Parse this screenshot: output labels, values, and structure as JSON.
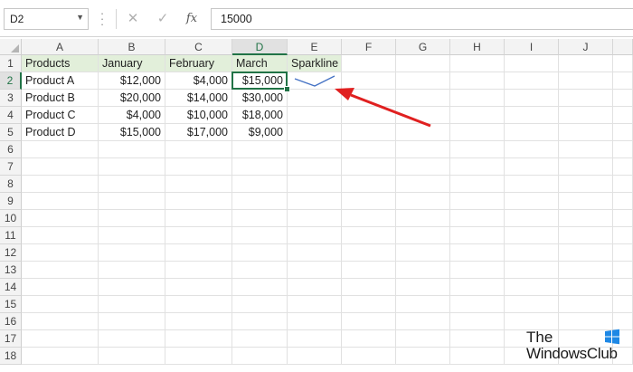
{
  "formula_bar": {
    "name_box": "D2",
    "cancel_icon": "✕",
    "enter_icon": "✓",
    "fx_label": "fx",
    "formula_value": "15000"
  },
  "columns": [
    "A",
    "B",
    "C",
    "D",
    "E",
    "F",
    "G",
    "H",
    "I",
    "J"
  ],
  "rows": [
    "1",
    "2",
    "3",
    "4",
    "5",
    "6",
    "7",
    "8",
    "9",
    "10",
    "11",
    "12",
    "13",
    "14",
    "15",
    "16",
    "17",
    "18"
  ],
  "selected_cell": "D2",
  "table": {
    "headers": [
      "Products",
      "January",
      "February",
      "March",
      "Sparkline"
    ],
    "data": [
      [
        "Product A",
        "$12,000",
        "$4,000",
        "$15,000"
      ],
      [
        "Product B",
        "$20,000",
        "$14,000",
        "$30,000"
      ],
      [
        "Product C",
        "$4,000",
        "$10,000",
        "$18,000"
      ],
      [
        "Product D",
        "$15,000",
        "$17,000",
        "$9,000"
      ]
    ]
  },
  "sparkline": {
    "cell": "E2",
    "values": [
      12000,
      4000,
      15000
    ],
    "color": "#4472c4"
  },
  "annotation": {
    "arrow_color": "#e02020"
  },
  "watermark": {
    "line1": "The",
    "line2": "WindowsClub",
    "icon": "windows-logo-icon",
    "icon_color": "#1e88e5"
  },
  "colors": {
    "accent": "#217346",
    "header_fill": "#e2efda"
  }
}
